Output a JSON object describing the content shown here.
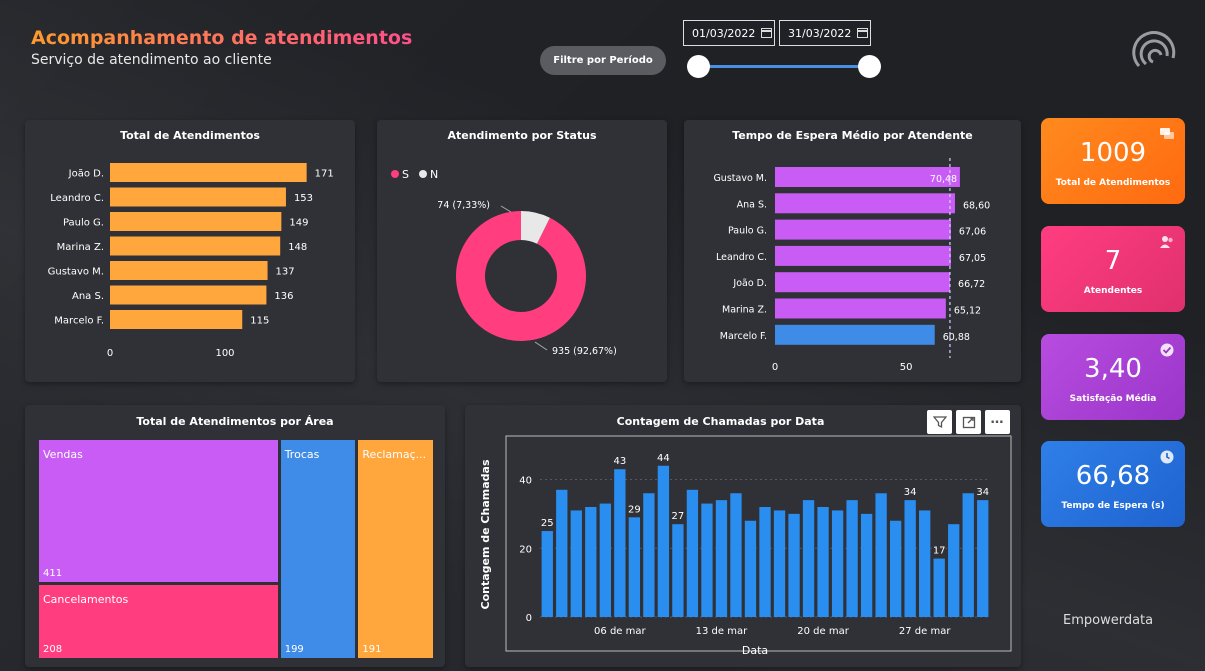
{
  "header": {
    "title": "Acompanhamento de atendimentos",
    "subtitle": "Serviço de atendimento ao cliente"
  },
  "filter": {
    "button_label": "Filtre por Período",
    "start_date": "01/03/2022",
    "end_date": "31/03/2022"
  },
  "panels": {
    "total": "Total de Atendimentos",
    "status": "Atendimento por Status",
    "wait": "Tempo de Espera Médio por Atendente",
    "area": "Total de Atendimentos por Área",
    "calls": "Contagem de Chamadas por Data"
  },
  "kpis": [
    {
      "value": "1009",
      "label": "Total de Atendimentos",
      "color_from": "#ff8a1e",
      "color_to": "#ff6a10",
      "icon": "chat-icon"
    },
    {
      "value": "7",
      "label": "Atendentes",
      "color_from": "#ff3d7f",
      "color_to": "#e0306e",
      "icon": "users-icon"
    },
    {
      "value": "3,40",
      "label": "Satisfação Média",
      "color_from": "#b84ce0",
      "color_to": "#9a35c9",
      "icon": "check-icon"
    },
    {
      "value": "66,68",
      "label": "Tempo de Espera (s)",
      "color_from": "#2f7fe8",
      "color_to": "#1f63cf",
      "icon": "clock-icon"
    }
  ],
  "brand": "Empowerdata",
  "chart_data": [
    {
      "type": "bar",
      "orientation": "horizontal",
      "title": "Total de Atendimentos",
      "categories": [
        "João D.",
        "Leandro C.",
        "Paulo G.",
        "Marina Z.",
        "Gustavo M.",
        "Ana S.",
        "Marcelo F."
      ],
      "values": [
        171,
        153,
        149,
        148,
        137,
        136,
        115
      ],
      "labels": [
        "171",
        "153",
        "149",
        "148",
        "137",
        "136",
        "115"
      ],
      "xticks": [
        "0",
        "100"
      ],
      "xlim": [
        0,
        200
      ],
      "color": "#ffa63d"
    },
    {
      "type": "pie",
      "subtype": "donut",
      "title": "Atendimento por Status",
      "legend": [
        "S",
        "N"
      ],
      "legend_position": "top-left",
      "values": [
        935,
        74
      ],
      "labels": [
        "935 (92,67%)",
        "74 (7,33%)"
      ],
      "colors": [
        "#ff3d7f",
        "#e8e8e8"
      ]
    },
    {
      "type": "bar",
      "orientation": "horizontal",
      "title": "Tempo de Espera Médio por Atendente",
      "categories": [
        "Gustavo M.",
        "Ana S.",
        "Paulo G.",
        "Leandro C.",
        "João D.",
        "Marina Z.",
        "Marcelo F."
      ],
      "values": [
        70.48,
        68.6,
        67.06,
        67.05,
        66.72,
        65.12,
        60.88
      ],
      "labels": [
        "70,48",
        "68,60",
        "67,06",
        "67,05",
        "66,72",
        "65,12",
        "60,88"
      ],
      "colors": [
        "#c95cf5",
        "#c95cf5",
        "#c95cf5",
        "#c95cf5",
        "#c95cf5",
        "#c95cf5",
        "#3f8be8"
      ],
      "xticks": [
        "0",
        "50"
      ],
      "xlim": [
        0,
        85
      ],
      "reference_line": 66.68
    },
    {
      "type": "treemap",
      "title": "Total de Atendimentos por Área",
      "items": [
        {
          "name": "Vendas",
          "value": 411,
          "label": "411",
          "color": "#c95cf5"
        },
        {
          "name": "Cancelamentos",
          "value": 208,
          "label": "208",
          "color": "#ff3d7f"
        },
        {
          "name": "Trocas",
          "value": 199,
          "label": "199",
          "color": "#3f8be8"
        },
        {
          "name": "Reclamaç...",
          "value": 191,
          "label": "191",
          "color": "#ffa63d"
        }
      ]
    },
    {
      "type": "bar",
      "title": "Contagem de Chamadas por Data",
      "xlabel": "Data",
      "ylabel": "Contagem de Chamadas",
      "ylim": [
        0,
        48
      ],
      "yticks": [
        "0",
        "20",
        "40"
      ],
      "xticks": [
        "06 de mar",
        "13 de mar",
        "20 de mar",
        "27 de mar"
      ],
      "xtick_days": [
        6,
        13,
        20,
        27
      ],
      "days": [
        1,
        2,
        3,
        4,
        5,
        6,
        7,
        8,
        9,
        10,
        11,
        12,
        13,
        14,
        15,
        16,
        17,
        18,
        19,
        20,
        21,
        22,
        23,
        24,
        25,
        26,
        27,
        28,
        29,
        30,
        31
      ],
      "values": [
        25,
        37,
        31,
        32,
        33,
        43,
        29,
        36,
        44,
        27,
        37,
        33,
        34,
        36,
        28,
        32,
        31,
        30,
        34,
        32,
        31,
        34,
        30,
        36,
        28,
        34,
        31,
        17,
        27,
        36,
        34
      ],
      "labeled": {
        "1": "25",
        "6": "43",
        "7": "29",
        "9": "44",
        "10": "27",
        "26": "34",
        "28": "17",
        "31": "34"
      },
      "color": "#2a8ef0"
    }
  ]
}
